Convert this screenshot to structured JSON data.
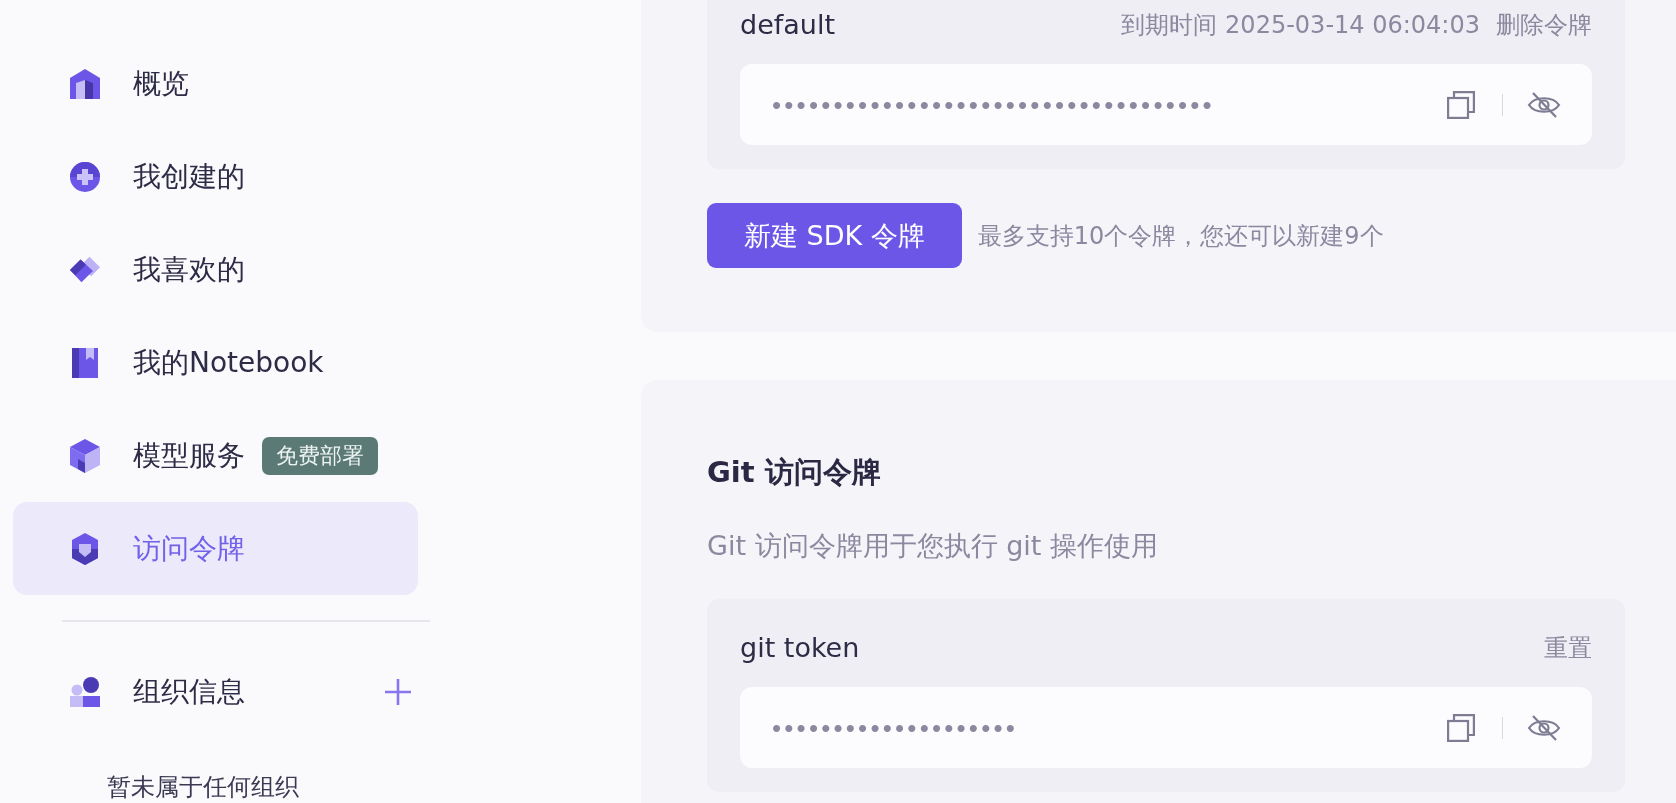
{
  "sidebar": {
    "items": [
      {
        "label": "概览",
        "selected": false
      },
      {
        "label": "我创建的",
        "selected": false
      },
      {
        "label": "我喜欢的",
        "selected": false
      },
      {
        "label": "我的Notebook",
        "selected": false
      },
      {
        "label": "模型服务",
        "selected": false,
        "badge": "免费部署"
      },
      {
        "label": "访问令牌",
        "selected": true
      }
    ],
    "organization": {
      "label": "组织信息",
      "empty_text": "暂未属于任何组织"
    }
  },
  "sdk_tokens": {
    "tokens": [
      {
        "name": "default",
        "expiry": "到期时间 2025-03-14 06:04:03",
        "delete_link": "删除令牌",
        "masked_value": "••••••••••••••••••••••••••••••••••••"
      }
    ],
    "create_button": "新建 SDK 令牌",
    "limit_hint": "最多支持10个令牌，您还可以新建9个"
  },
  "git_tokens": {
    "title": "Git 访问令牌",
    "description": "Git 访问令牌用于您执行 git 操作使用",
    "tokens": [
      {
        "name": "git token",
        "reset_link": "重置",
        "masked_value": "••••••••••••••••••••"
      }
    ]
  }
}
